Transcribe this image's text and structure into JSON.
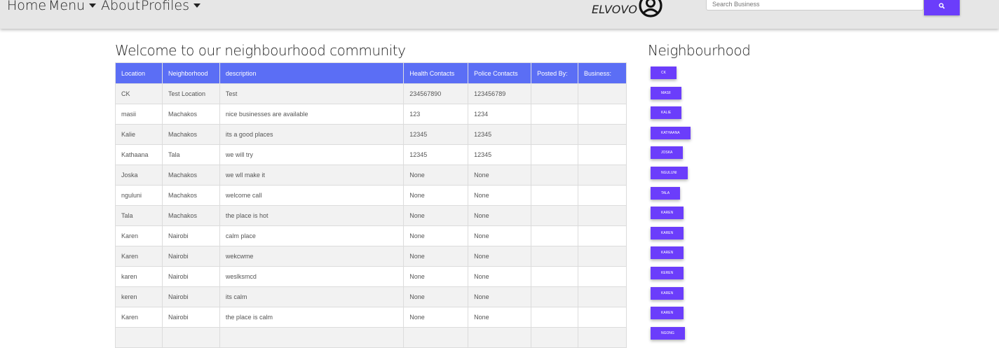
{
  "nav": {
    "home": "Home",
    "menu": "Menu",
    "about": "About",
    "profiles": "Profiles",
    "brand": "ELVOVO",
    "search_placeholder": "Search Business",
    "brand_icon": "user-circle-icon",
    "search_icon": "search-icon"
  },
  "main": {
    "title": "Welcome to our neighbourhood community",
    "columns": [
      "Location",
      "Neighborhood",
      "description",
      "Health Contacts",
      "Police Contacts",
      "Posted By:",
      "Business:"
    ],
    "rows": [
      [
        "CK",
        "Test Location",
        "Test",
        "234567890",
        "123456789",
        "",
        ""
      ],
      [
        "masii",
        "Machakos",
        "nice businesses are available",
        "123",
        "1234",
        "",
        ""
      ],
      [
        "Kalie",
        "Machakos",
        "its a good places",
        "12345",
        "12345",
        "",
        ""
      ],
      [
        "Kathaana",
        "Tala",
        "we will try",
        "12345",
        "12345",
        "",
        ""
      ],
      [
        "Joska",
        "Machakos",
        "we wll make it",
        "None",
        "None",
        "",
        ""
      ],
      [
        "nguluni",
        "Machakos",
        "welcome call",
        "None",
        "None",
        "",
        ""
      ],
      [
        "Tala",
        "Machakos",
        "the place is hot",
        "None",
        "None",
        "",
        ""
      ],
      [
        "Karen",
        "Nairobi",
        "calm place",
        "None",
        "None",
        "",
        ""
      ],
      [
        "Karen",
        "Nairobi",
        "wekcwme",
        "None",
        "None",
        "",
        ""
      ],
      [
        "karen",
        "Nairobi",
        "weslksmcd",
        "None",
        "None",
        "",
        ""
      ],
      [
        "keren",
        "Nairobi",
        "its calm",
        "None",
        "None",
        "",
        ""
      ],
      [
        "Karen",
        "Nairobi",
        "the place is calm",
        "None",
        "None",
        "",
        ""
      ],
      [
        "",
        "",
        "",
        "",
        "",
        "",
        ""
      ]
    ]
  },
  "sidebar": {
    "title": "Neighbourhood",
    "items": [
      "CK",
      "masii",
      "Kalie",
      "Kathaana",
      "Joska",
      "nguluni",
      "Tala",
      "Karen",
      "Karen",
      "karen",
      "keren",
      "Karen",
      "Karen",
      "ngong"
    ]
  },
  "colors": {
    "accent": "#6b3dfb",
    "table_header": "#5b6ef5",
    "navbar": "#e6e6e6"
  }
}
